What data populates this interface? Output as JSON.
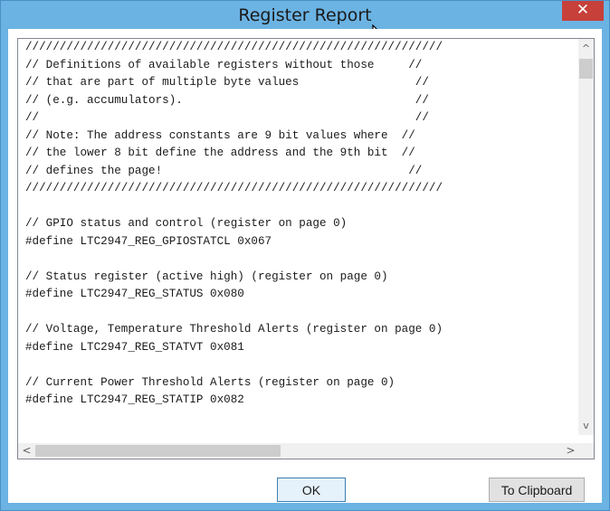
{
  "window": {
    "title": "Register Report",
    "close_label": "✕"
  },
  "code_lines": [
    "/////////////////////////////////////////////////////////////",
    "// Definitions of available registers without those     //",
    "// that are part of multiple byte values                 //",
    "// (e.g. accumulators).                                  //",
    "//                                                       //",
    "// Note: The address constants are 9 bit values where  //",
    "// the lower 8 bit define the address and the 9th bit  //",
    "// defines the page!                                    //",
    "/////////////////////////////////////////////////////////////",
    "",
    "// GPIO status and control (register on page 0)",
    "#define LTC2947_REG_GPIOSTATCL 0x067",
    "",
    "// Status register (active high) (register on page 0)",
    "#define LTC2947_REG_STATUS 0x080",
    "",
    "// Voltage, Temperature Threshold Alerts (register on page 0)",
    "#define LTC2947_REG_STATVT 0x081",
    "",
    "// Current Power Threshold Alerts (register on page 0)",
    "#define LTC2947_REG_STATIP 0x082"
  ],
  "scroll": {
    "up_arrow": "^",
    "down_arrow": "v",
    "left_arrow": "<",
    "right_arrow": ">"
  },
  "buttons": {
    "ok": "OK",
    "clipboard": "To Clipboard"
  },
  "colors": {
    "titlebar": "#6bb3e3",
    "close": "#c7403a"
  }
}
